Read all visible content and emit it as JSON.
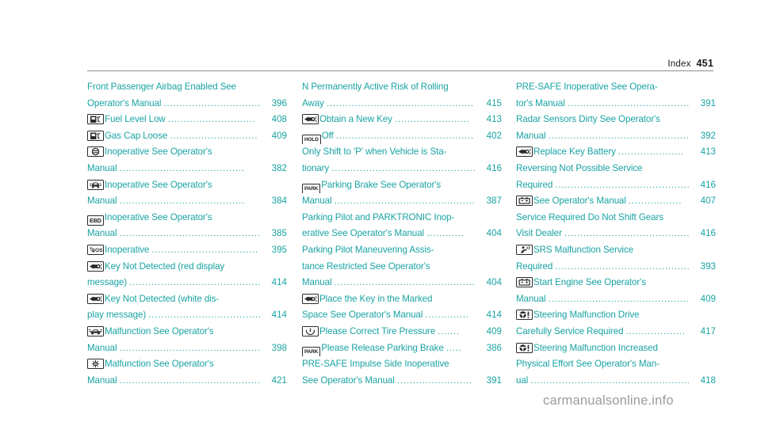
{
  "header": {
    "label": "Index",
    "page_number": "451"
  },
  "colors": {
    "entry_text": "#1aa3a3",
    "header_text": "#1a1a1a",
    "icon_stroke": "#2b2b2b",
    "watermark": "#9b9b9b",
    "rule": "#8f8f8f"
  },
  "watermark": "carmanualsonline.info",
  "columns": [
    {
      "id": "column-1",
      "entries": [
        {
          "icon": null,
          "lines": [
            {
              "text": "Front Passenger Airbag Enabled See",
              "leader": "",
              "page": ""
            },
            {
              "text": "Operator's Manual",
              "leader": "...............................",
              "page": "396"
            }
          ]
        },
        {
          "icon": "fuel-pump-low-icon",
          "lines": [
            {
              "text": "Fuel Level Low",
              "leader": "............................",
              "page": "408"
            }
          ]
        },
        {
          "icon": "fuel-pump-gas-cap-icon",
          "lines": [
            {
              "text": "Gas Cap Loose",
              "leader": "............................",
              "page": "409"
            }
          ]
        },
        {
          "icon": "esp-inoperative-icon",
          "lines": [
            {
              "text": "Inoperative See Operator's",
              "leader": "",
              "page": ""
            },
            {
              "text": "Manual",
              "leader": "........................................",
              "page": "382"
            }
          ]
        },
        {
          "icon": "abs-vehicle-icon",
          "lines": [
            {
              "text": "Inoperative See Operator's",
              "leader": "",
              "page": ""
            },
            {
              "text": "Manual",
              "leader": "........................................",
              "page": "384"
            }
          ]
        },
        {
          "icon": "ebd-icon",
          "lines": [
            {
              "text": "Inoperative See Operator's",
              "leader": "",
              "page": ""
            },
            {
              "text": "Manual",
              "leader": "................................................",
              "page": "385"
            }
          ]
        },
        {
          "icon": "sos-phone-icon",
          "lines": [
            {
              "text": "Inoperative",
              "leader": "..................................",
              "page": "395"
            }
          ]
        },
        {
          "icon": "key-fob-icon",
          "lines": [
            {
              "text": "Key Not Detected  (red display",
              "leader": "",
              "page": ""
            },
            {
              "text": "message)",
              "leader": ".............................................",
              "page": "414"
            }
          ]
        },
        {
          "icon": "key-fob-icon",
          "lines": [
            {
              "text": "Key Not Detected  (white dis-",
              "leader": "",
              "page": ""
            },
            {
              "text": "play message)",
              "leader": "......................................",
              "page": "414"
            }
          ]
        },
        {
          "icon": "car-malfunction-icon",
          "lines": [
            {
              "text": "Malfunction See Operator's",
              "leader": "",
              "page": ""
            },
            {
              "text": "Manual",
              "leader": "................................................",
              "page": "398"
            }
          ]
        },
        {
          "icon": "engine-fan-icon",
          "lines": [
            {
              "text": "Malfunction See Operator's",
              "leader": "",
              "page": ""
            },
            {
              "text": "Manual",
              "leader": ".................................................",
              "page": "421"
            }
          ]
        }
      ]
    },
    {
      "id": "column-2",
      "entries": [
        {
          "icon": null,
          "lines": [
            {
              "text": "N Permanently Active Risk of Rolling",
              "leader": "",
              "page": ""
            },
            {
              "text": "Away",
              "leader": "...................................................",
              "page": "415"
            }
          ]
        },
        {
          "icon": "key-fob-icon",
          "lines": [
            {
              "text": "Obtain a New Key",
              "leader": "........................",
              "page": "413"
            }
          ]
        },
        {
          "icon": "hold-icon",
          "lines": [
            {
              "text": "Off",
              "leader": "...............................................",
              "page": "402"
            }
          ]
        },
        {
          "icon": null,
          "lines": [
            {
              "text": "Only Shift to 'P' when Vehicle is Sta-",
              "leader": "",
              "page": ""
            },
            {
              "text": "tionary",
              "leader": "...............................................",
              "page": "416"
            }
          ]
        },
        {
          "icon": "park-icon",
          "lines": [
            {
              "text": "Parking Brake See Operator's",
              "leader": "",
              "page": ""
            },
            {
              "text": "Manual",
              "leader": "................................................",
              "page": "387"
            }
          ]
        },
        {
          "icon": null,
          "lines": [
            {
              "text": "Parking Pilot and PARKTRONIC Inop-",
              "leader": "",
              "page": ""
            },
            {
              "text": "erative See Operator's Manual",
              "leader": "............",
              "page": "404"
            }
          ]
        },
        {
          "icon": null,
          "lines": [
            {
              "text": "Parking Pilot Maneuvering Assis-",
              "leader": "",
              "page": ""
            },
            {
              "text": "tance Restricted See Operator's",
              "leader": "",
              "page": ""
            },
            {
              "text": "Manual",
              "leader": "................................................",
              "page": "404"
            }
          ]
        },
        {
          "icon": "key-fob-icon",
          "lines": [
            {
              "text": "Place the Key in the Marked",
              "leader": "",
              "page": ""
            },
            {
              "text": "Space See Operator's Manual",
              "leader": "..............",
              "page": "414"
            }
          ]
        },
        {
          "icon": "tire-pressure-icon",
          "lines": [
            {
              "text": "Please Correct Tire Pressure",
              "leader": ".......",
              "page": "409"
            }
          ]
        },
        {
          "icon": "park-icon",
          "lines": [
            {
              "text": "Please Release Parking Brake",
              "leader": ".....",
              "page": "386"
            }
          ]
        },
        {
          "icon": null,
          "lines": [
            {
              "text": "PRE-SAFE Impulse Side Inoperative",
              "leader": "",
              "page": ""
            },
            {
              "text": "See Operator's Manual",
              "leader": "........................",
              "page": "391"
            }
          ]
        }
      ]
    },
    {
      "id": "column-3",
      "entries": [
        {
          "icon": null,
          "lines": [
            {
              "text": "PRE-SAFE Inoperative See Opera-",
              "leader": "",
              "page": ""
            },
            {
              "text": "tor's Manual",
              "leader": "........................................",
              "page": "391"
            }
          ]
        },
        {
          "icon": null,
          "lines": [
            {
              "text": "Radar Sensors Dirty See Operator's",
              "leader": "",
              "page": ""
            },
            {
              "text": "Manual",
              "leader": "................................................",
              "page": "392"
            }
          ]
        },
        {
          "icon": "key-fob-icon",
          "lines": [
            {
              "text": "Replace Key Battery",
              "leader": ".....................",
              "page": "413"
            }
          ]
        },
        {
          "icon": null,
          "lines": [
            {
              "text": "Reversing Not Possible Service",
              "leader": "",
              "page": ""
            },
            {
              "text": "Required",
              "leader": "..............................................",
              "page": "416"
            }
          ]
        },
        {
          "icon": "battery-icon",
          "lines": [
            {
              "text": "See Operator's Manual",
              "leader": ".................",
              "page": "407"
            }
          ]
        },
        {
          "icon": null,
          "lines": [
            {
              "text": "Service Required Do Not Shift Gears",
              "leader": "",
              "page": ""
            },
            {
              "text": "Visit Dealer",
              "leader": "..........................................",
              "page": "416"
            }
          ]
        },
        {
          "icon": "srs-airbag-icon",
          "lines": [
            {
              "text": "SRS Malfunction Service",
              "leader": "",
              "page": ""
            },
            {
              "text": "Required",
              "leader": "..............................................",
              "page": "393"
            }
          ]
        },
        {
          "icon": "battery-icon",
          "lines": [
            {
              "text": "Start Engine See Operator's",
              "leader": "",
              "page": ""
            },
            {
              "text": "Manual",
              "leader": "................................................",
              "page": "409"
            }
          ]
        },
        {
          "icon": "steering-wheel-warning-icon",
          "lines": [
            {
              "text": "Steering Malfunction Drive",
              "leader": "",
              "page": ""
            },
            {
              "text": "Carefully Service Required",
              "leader": "...................",
              "page": "417"
            }
          ]
        },
        {
          "icon": "steering-wheel-warning-icon",
          "lines": [
            {
              "text": "Steering Malfunction Increased",
              "leader": "",
              "page": ""
            },
            {
              "text": "Physical Effort See Operator's Man-",
              "leader": "",
              "page": ""
            },
            {
              "text": "ual",
              "leader": "........................................................",
              "page": "418"
            }
          ]
        }
      ]
    }
  ]
}
